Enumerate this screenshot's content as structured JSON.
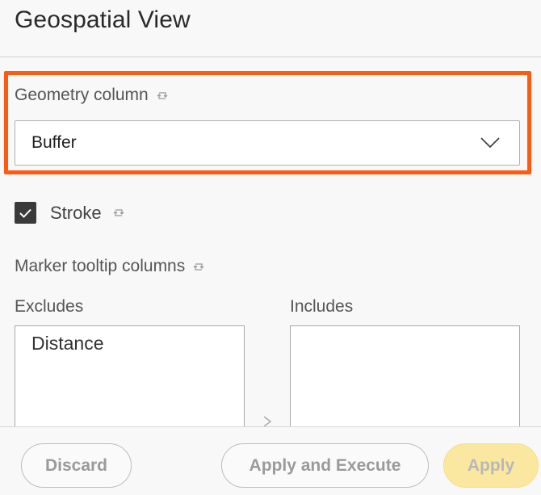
{
  "panel": {
    "title": "Geospatial View"
  },
  "geometry_column": {
    "label": "Geometry column",
    "value": "Buffer"
  },
  "stroke": {
    "label": "Stroke",
    "checked": true
  },
  "marker_tooltip": {
    "label": "Marker tooltip columns",
    "excludes_label": "Excludes",
    "includes_label": "Includes",
    "excludes_items": [
      "Distance"
    ],
    "includes_items": []
  },
  "footer": {
    "discard_label": "Discard",
    "apply_execute_label": "Apply and Execute",
    "apply_label": "Apply"
  },
  "colors": {
    "highlight": "#ff5a10",
    "checkbox": "#3a3a3a",
    "apply_button": "#fbe8a0"
  }
}
